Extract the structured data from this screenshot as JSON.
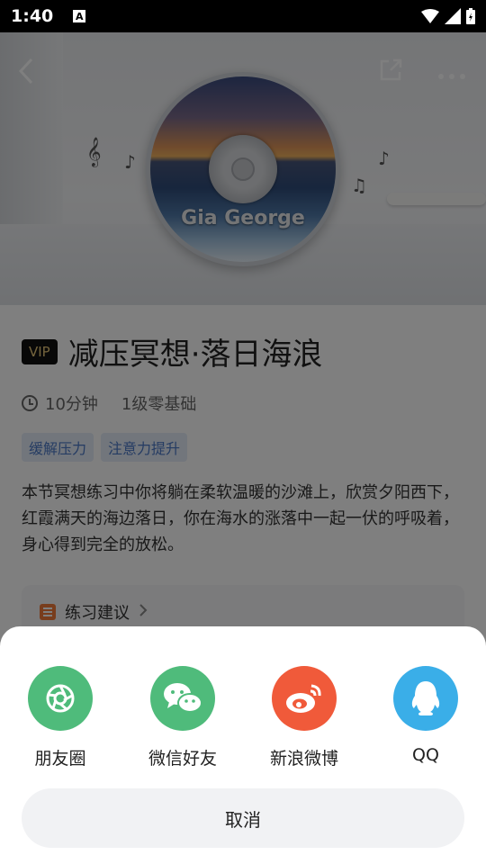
{
  "status_bar": {
    "time": "1:40",
    "notification_icon": "A"
  },
  "hero": {
    "disc_text": "Gia George"
  },
  "course": {
    "vip_badge": "VIP",
    "title": "减压冥想·落日海浪",
    "duration": "10分钟",
    "level": "1级零基础",
    "tags": [
      "缓解压力",
      "注意力提升"
    ],
    "description": "本节冥想练习中你将躺在柔软温暖的沙滩上，欣赏夕阳西下，红霞满天的海边落日，你在海水的涨落中一起一伏的呼吸着，身心得到完全的放松。",
    "advice_label": "练习建议"
  },
  "share_sheet": {
    "options": [
      {
        "label": "朋友圈",
        "icon": "moments-icon",
        "color": "#4fbb7b"
      },
      {
        "label": "微信好友",
        "icon": "wechat-icon",
        "color": "#4fbb7b"
      },
      {
        "label": "新浪微博",
        "icon": "weibo-icon",
        "color": "#f05a3a"
      },
      {
        "label": "QQ",
        "icon": "qq-icon",
        "color": "#3aaee8"
      }
    ],
    "cancel_label": "取消"
  }
}
